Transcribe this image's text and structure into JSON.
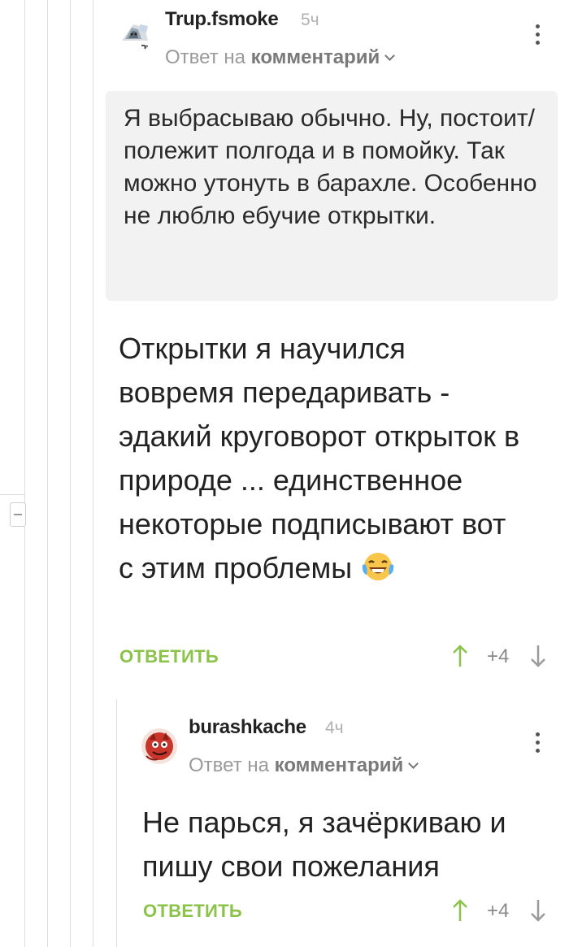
{
  "comment_parent": {
    "username": "Trup.fsmoke",
    "time": "5ч",
    "reply_prefix": "Ответ на",
    "reply_target": "комментарий",
    "quote": "Я выбрасываю обычно. Ну, постоит/полежит полгода и в помойку. Так можно утонуть в барахле. Особенно не люблю ебучие открытки.",
    "body": "Открытки я научился вовремя передаривать - эдакий круговорот открыток в природе ... единственное некоторые подписывают вот с этим проблемы",
    "reply_label": "ОТВЕТИТЬ",
    "score": "+4"
  },
  "comment_child": {
    "username": "burashkache",
    "time": "4ч",
    "reply_prefix": "Ответ на",
    "reply_target": "комментарий",
    "body": "Не парься, я зачёркиваю и пишу свои пожелания",
    "reply_label": "ОТВЕТИТЬ",
    "score": "+4"
  },
  "colors": {
    "accent_green": "#8bc34a",
    "quote_bg": "#f2f2f2",
    "meta_gray": "#9a9a9a"
  },
  "icons": [
    "avatar-cat-icon",
    "avatar-creature-icon",
    "more-vertical-icon",
    "chevron-down-icon",
    "arrow-up-icon",
    "arrow-down-icon",
    "laughing-tears-emoji-icon",
    "collapse-minus-icon"
  ]
}
